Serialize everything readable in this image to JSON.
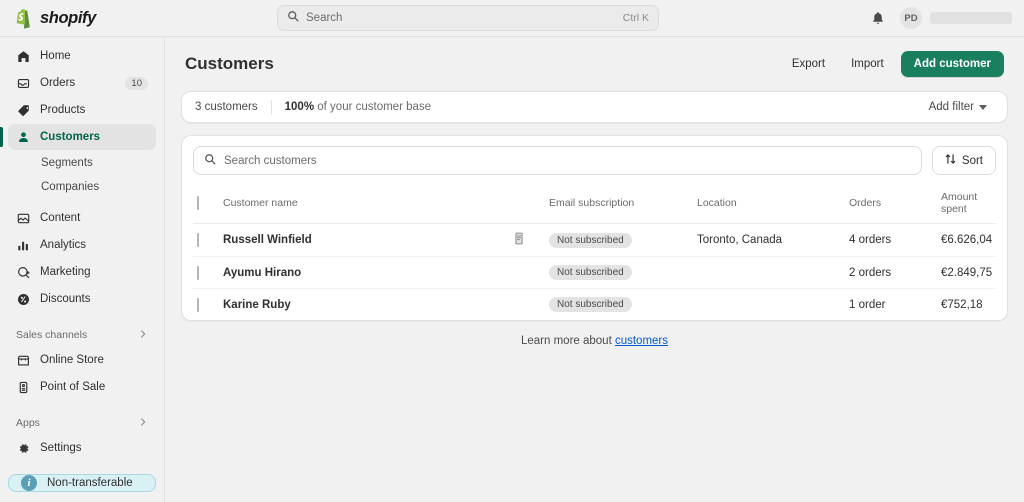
{
  "topbar": {
    "brand_name": "shopify",
    "brand_icon": "shopify-bag-icon",
    "search": {
      "placeholder": "Search",
      "shortcut": "Ctrl K",
      "icon": "search-icon"
    },
    "notifications_icon": "bell-icon",
    "avatar_initials": "PD"
  },
  "sidebar": {
    "items": [
      {
        "label": "Home",
        "icon": "home-icon",
        "badge": ""
      },
      {
        "label": "Orders",
        "icon": "orders-icon",
        "badge": "10"
      },
      {
        "label": "Products",
        "icon": "products-tag-icon",
        "badge": ""
      },
      {
        "label": "Customers",
        "icon": "customers-person-icon",
        "badge": "",
        "active": true
      },
      {
        "label": "Content",
        "icon": "content-image-icon",
        "badge": ""
      },
      {
        "label": "Analytics",
        "icon": "analytics-bars-icon",
        "badge": ""
      },
      {
        "label": "Marketing",
        "icon": "marketing-megaphone-icon",
        "badge": ""
      },
      {
        "label": "Discounts",
        "icon": "discounts-icon",
        "badge": ""
      }
    ],
    "sub_items": [
      {
        "label": "Segments"
      },
      {
        "label": "Companies"
      }
    ],
    "sales_channels": {
      "label": "Sales channels",
      "chevron": "chevron-right-icon"
    },
    "channels": [
      {
        "label": "Online Store",
        "icon": "online-store-icon"
      },
      {
        "label": "Point of Sale",
        "icon": "point-of-sale-icon"
      }
    ],
    "apps": {
      "label": "Apps",
      "chevron": "chevron-right-icon"
    },
    "settings": {
      "label": "Settings",
      "icon": "gear-icon"
    },
    "banner": {
      "label": "Non-transferable",
      "icon": "info-icon"
    }
  },
  "page": {
    "title": "Customers",
    "export_label": "Export",
    "import_label": "Import",
    "add_customer_label": "Add customer"
  },
  "statbar": {
    "count_label": "3 customers",
    "base_percent": "100%",
    "base_suffix": " of your customer base",
    "add_filter_label": "Add filter"
  },
  "list": {
    "search_placeholder": "Search customers",
    "search_icon": "search-icon",
    "sort_label": "Sort",
    "sort_icon": "sort-arrows-icon",
    "columns": {
      "name": "Customer name",
      "subscription": "Email subscription",
      "location": "Location",
      "orders": "Orders",
      "amount": "Amount spent"
    },
    "rows": [
      {
        "name": "Russell Winfield",
        "note_icon": "note-icon",
        "has_note": true,
        "subscription": "Not subscribed",
        "location": "Toronto, Canada",
        "orders": "4 orders",
        "amount": "€6.626,04"
      },
      {
        "name": "Ayumu Hirano",
        "note_icon": "",
        "has_note": false,
        "subscription": "Not subscribed",
        "location": "",
        "orders": "2 orders",
        "amount": "€2.849,75"
      },
      {
        "name": "Karine Ruby",
        "note_icon": "",
        "has_note": false,
        "subscription": "Not subscribed",
        "location": "",
        "orders": "1 order",
        "amount": "€752,18"
      }
    ]
  },
  "footer": {
    "text_prefix": "Learn more about ",
    "link_label": "customers"
  },
  "colors": {
    "brand_green": "#1a7f5f",
    "active_green": "#00654a",
    "link_blue": "#005bd3",
    "banner_blue": "#d9f0f5"
  }
}
